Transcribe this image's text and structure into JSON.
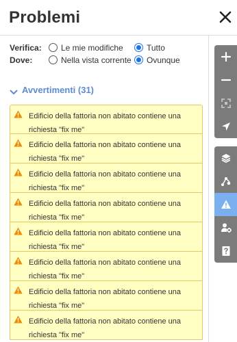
{
  "header": {
    "title": "Problemi"
  },
  "options": {
    "verifica": {
      "label": "Verifica:",
      "choices": [
        "Le mie modifiche",
        "Tutto"
      ],
      "selected": "Tutto"
    },
    "dove": {
      "label": "Dove:",
      "choices": [
        "Nella vista corrente",
        "Ovunque"
      ],
      "selected": "Ovunque"
    }
  },
  "warnings": {
    "heading": "Avvertimenti (31)",
    "items": [
      {
        "message": "Edificio della fattoria non abitato contiene una richiesta \"fix me\""
      },
      {
        "message": "Edificio della fattoria non abitato contiene una richiesta \"fix me\""
      },
      {
        "message": "Edificio della fattoria non abitato contiene una richiesta \"fix me\""
      },
      {
        "message": "Edificio della fattoria non abitato contiene una richiesta \"fix me\""
      },
      {
        "message": "Edificio della fattoria non abitato contiene una richiesta \"fix me\""
      },
      {
        "message": "Edificio della fattoria non abitato contiene una richiesta \"fix me\""
      },
      {
        "message": "Edificio della fattoria non abitato contiene una richiesta \"fix me\""
      },
      {
        "message": "Edificio della fattoria non abitato contiene una richiesta \"fix me\""
      }
    ]
  },
  "map_controls": {
    "zoom": [
      "zoom-in-icon",
      "zoom-out-icon",
      "zoom-to-selection-icon",
      "geolocate-icon"
    ],
    "panes": [
      "layers-icon",
      "map-data-icon",
      "issues-icon",
      "preferences-icon",
      "help-icon"
    ],
    "active_pane": "issues-icon"
  },
  "colors": {
    "accent": "#1a73e8",
    "heading_link": "#5b8bd6",
    "warning_bg": "#ffffc4",
    "warning_border": "#e8c663",
    "warning_icon": "#f08c00",
    "control_bg": "#7b7b7b",
    "control_active": "#7ab0ef"
  }
}
